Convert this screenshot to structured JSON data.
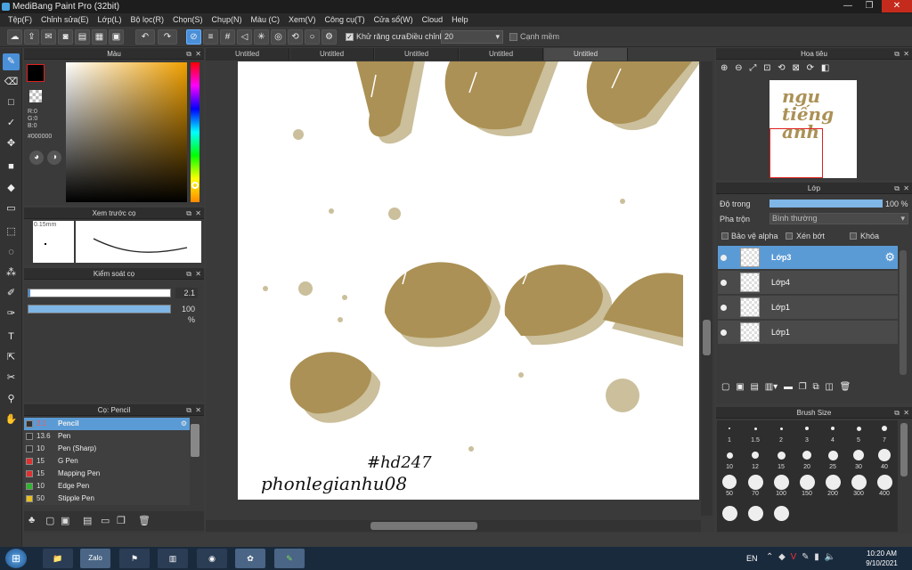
{
  "window": {
    "title": "MediBang Paint Pro (32bit)",
    "minimize": "—",
    "maximize": "❐",
    "close": "✕"
  },
  "menu": [
    "Tệp(F)",
    "Chỉnh sửa(E)",
    "Lớp(L)",
    "Bộ lọc(R)",
    "Chọn(S)",
    "Chụp(N)",
    "Màu (C)",
    "Xem(V)",
    "Công cụ(T)",
    "Cửa sổ(W)",
    "Cloud",
    "Help"
  ],
  "toolbar": {
    "antialias_label": "Khử răng cưa",
    "adjust_label": "Điều chỉnh",
    "adjust_value": "20",
    "edge_label": "Cạnh mềm"
  },
  "color_panel": {
    "title": "Màu",
    "r": "R:0",
    "g": "G:0",
    "b": "B:0",
    "hex": "#000000",
    "fg_color": "#000000"
  },
  "brush_preview": {
    "title": "Xem trước cọ",
    "size_label": "0.15mm"
  },
  "brush_control": {
    "title": "Kiểm soát cọ",
    "size_value": "2.1",
    "opacity_value": "100 %",
    "opacity_fraction": 1.0
  },
  "brush_list": {
    "title": "Cọ: Pencil",
    "items": [
      {
        "size": "2.1",
        "name": "Pencil",
        "color": "#333333",
        "selected": true
      },
      {
        "size": "13.6",
        "name": "Pen",
        "color": "#333333"
      },
      {
        "size": "10",
        "name": "Pen (Sharp)",
        "color": "#333333"
      },
      {
        "size": "15",
        "name": "G Pen",
        "color": "#e03030"
      },
      {
        "size": "15",
        "name": "Mapping Pen",
        "color": "#e03030"
      },
      {
        "size": "10",
        "name": "Edge Pen",
        "color": "#2fb52f"
      },
      {
        "size": "50",
        "name": "Stipple Pen",
        "color": "#e8c020"
      }
    ]
  },
  "doc_tabs": [
    "Untitled",
    "Untitled",
    "Untitled",
    "Untitled",
    "Untitled"
  ],
  "canvas_text": {
    "line1": "#hd247",
    "line2": "phonlegianhu08"
  },
  "navigator": {
    "title": "Hoa tiêu",
    "thumb_text": "ngu tiếng anh"
  },
  "layers_panel": {
    "title": "Lớp",
    "opacity_label": "Độ trong",
    "opacity_value": "100 %",
    "opacity_fraction": 1.0,
    "blend_label": "Pha trộn",
    "blend_value": "Bình thường",
    "protect_alpha": "Bảo vệ alpha",
    "clipping": "Xén bớt",
    "lock": "Khóa",
    "layers": [
      {
        "name": "Lớp3",
        "selected": true
      },
      {
        "name": "Lớp4"
      },
      {
        "name": "Lớp1"
      },
      {
        "name": "Lớp1"
      }
    ]
  },
  "brush_size": {
    "title": "Brush Size",
    "sizes": [
      "1",
      "1.5",
      "2",
      "3",
      "4",
      "5",
      "7",
      "10",
      "12",
      "15",
      "20",
      "25",
      "30",
      "40",
      "50",
      "70",
      "100",
      "150",
      "200",
      "300",
      "400"
    ]
  },
  "taskbar": {
    "lang": "EN",
    "time": "10:20 AM",
    "date": "9/10/2021",
    "zalo": "Zalo"
  }
}
